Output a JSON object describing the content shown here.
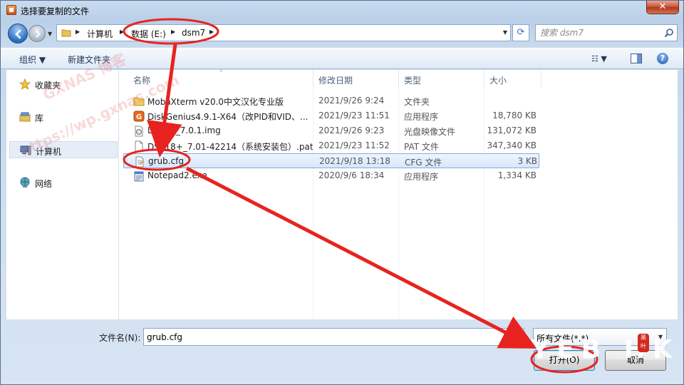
{
  "window": {
    "title": "选择要复制的文件",
    "close_label": "✕"
  },
  "address": {
    "crumbs": [
      "计算机",
      "数据 (E:)",
      "dsm7"
    ],
    "search_placeholder": "搜索 dsm7"
  },
  "toolbar": {
    "organize_label": "组织 ▼",
    "new_folder_label": "新建文件夹",
    "help_label": "?"
  },
  "nav_pane": {
    "items": [
      {
        "label": "收藏夹",
        "icon": "star-icon"
      },
      {
        "label": "库",
        "icon": "library-icon"
      },
      {
        "label": "计算机",
        "icon": "computer-icon",
        "selected": true
      },
      {
        "label": "网络",
        "icon": "network-icon"
      }
    ]
  },
  "file_list": {
    "columns": [
      "名称",
      "修改日期",
      "类型",
      "大小"
    ],
    "rows": [
      {
        "name": "MobaXterm v20.0中文汉化专业版",
        "date": "2021/9/26 9:24",
        "type": "文件夹",
        "size": "",
        "icon": "folder-icon"
      },
      {
        "name": "DiskGenius4.9.1-X64（改PID和VID、...",
        "date": "2021/9/23 11:51",
        "type": "应用程序",
        "size": "18,780 KB",
        "icon": "diskgenius-app-icon"
      },
      {
        "name": "DS918_7.0.1.img",
        "date": "2021/9/26 9:23",
        "type": "光盘映像文件",
        "size": "131,072 KB",
        "icon": "disc-image-icon"
      },
      {
        "name": "DS918+_7.01-42214（系统安装包）.pat",
        "date": "2021/9/23 11:52",
        "type": "PAT 文件",
        "size": "347,340 KB",
        "icon": "blank-file-icon"
      },
      {
        "name": "grub.cfg",
        "date": "2021/9/18 13:18",
        "type": "CFG 文件",
        "size": "3 KB",
        "icon": "config-file-icon",
        "selected": true
      },
      {
        "name": "Notepad2.exe",
        "date": "2020/9/6 18:34",
        "type": "应用程序",
        "size": "1,334 KB",
        "icon": "notepad-app-icon"
      }
    ]
  },
  "footer": {
    "filename_label": "文件名(N):",
    "filename_value": "grub.cfg",
    "filetype_value": "所有文件(*.*)",
    "open_label": "打开(O)",
    "cancel_label": "取消"
  },
  "annotations": {
    "watermark_lines": [
      "GXNAS 博客",
      "https://wp.gxnas.com"
    ],
    "corner_mark": "YEB HK",
    "seal_text": "黑\n叶",
    "highlight_color": "#e8231f"
  }
}
